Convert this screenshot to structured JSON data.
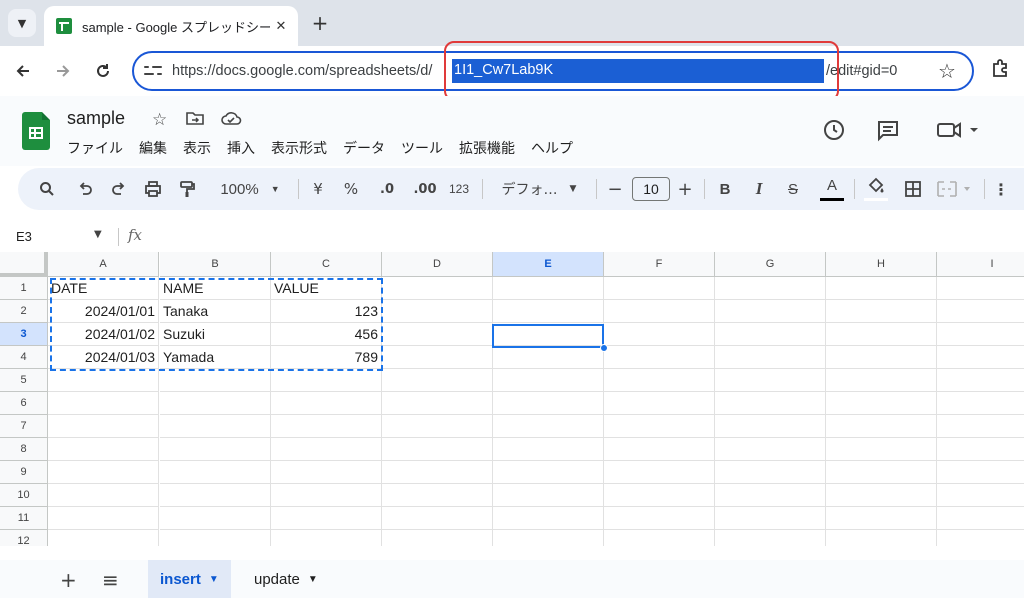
{
  "browser": {
    "tab_title": "sample - Google スプレッドシート",
    "tab_close": "✕",
    "new_tab": "+",
    "url_prefix": "https://docs.google.com/spreadsheets/d/",
    "url_selected": "1I1_Cw7Lab9K",
    "url_suffix": "/edit#gid=0"
  },
  "doc": {
    "title": "sample",
    "menu": [
      "ファイル",
      "編集",
      "表示",
      "挿入",
      "表示形式",
      "データ",
      "ツール",
      "拡張機能",
      "ヘルプ"
    ]
  },
  "toolbar": {
    "zoom": "100%",
    "currency": "¥",
    "percent": "%",
    "decimal_decrease": ".0",
    "decimal_increase": ".00",
    "number_format": "123",
    "font": "デフォ…",
    "font_size": "10",
    "bold": "B",
    "italic": "I",
    "strikethrough": "S",
    "text_color": "A"
  },
  "formula_bar": {
    "name_box": "E3",
    "fx": "fx"
  },
  "grid": {
    "columns": [
      "A",
      "B",
      "C",
      "D",
      "E",
      "F",
      "G",
      "H",
      "I"
    ],
    "rows": [
      "1",
      "2",
      "3",
      "4",
      "5",
      "6",
      "7",
      "8",
      "9",
      "10",
      "11",
      "12"
    ],
    "active_cell": "E3",
    "cells": [
      [
        {
          "v": "DATE",
          "num": false
        },
        {
          "v": "NAME",
          "num": false
        },
        {
          "v": "VALUE",
          "num": false
        }
      ],
      [
        {
          "v": "2024/01/01",
          "num": true
        },
        {
          "v": "Tanaka",
          "num": false
        },
        {
          "v": "123",
          "num": true
        }
      ],
      [
        {
          "v": "2024/01/02",
          "num": true
        },
        {
          "v": "Suzuki",
          "num": false
        },
        {
          "v": "456",
          "num": true
        }
      ],
      [
        {
          "v": "2024/01/03",
          "num": true
        },
        {
          "v": "Yamada",
          "num": false
        },
        {
          "v": "789",
          "num": true
        }
      ]
    ]
  },
  "sheets": {
    "tabs": [
      {
        "label": "insert",
        "active": true
      },
      {
        "label": "update",
        "active": false
      }
    ]
  },
  "colors": {
    "accent": "#1a73e8",
    "annotation": "#e03a3a",
    "url_highlight": "#1b5fd4",
    "sheets_green": "#1e8e3e"
  }
}
